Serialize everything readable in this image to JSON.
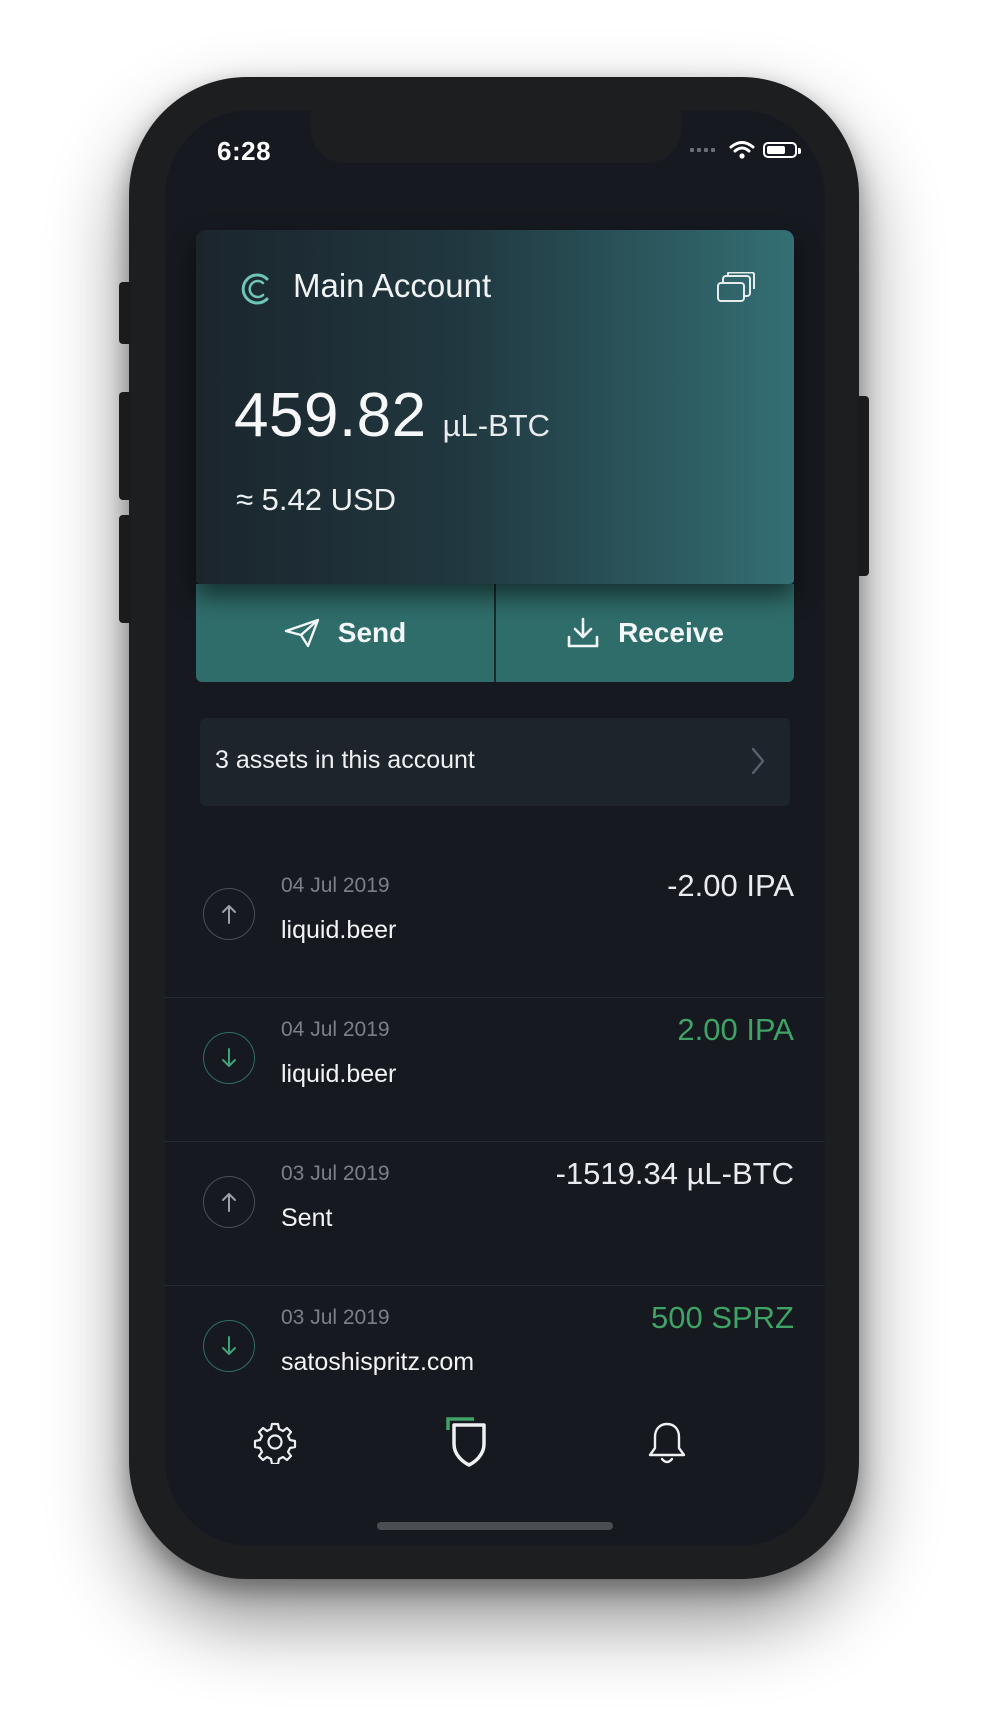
{
  "status_bar": {
    "time": "6:28"
  },
  "account_card": {
    "name": "Main Account",
    "balance": "459.82",
    "unit": "µL-BTC",
    "fiat": "≈ 5.42 USD"
  },
  "actions": {
    "send": "Send",
    "receive": "Receive"
  },
  "assets": {
    "label": "3 assets in this account"
  },
  "transactions": [
    {
      "date": "04 Jul 2019",
      "name": "liquid.beer",
      "amount": "-2.00 IPA",
      "direction": "outgoing"
    },
    {
      "date": "04 Jul 2019",
      "name": "liquid.beer",
      "amount": "2.00 IPA",
      "direction": "incoming"
    },
    {
      "date": "03 Jul 2019",
      "name": "Sent",
      "amount": "-1519.34 µL-BTC",
      "direction": "outgoing"
    },
    {
      "date": "03 Jul 2019",
      "name": "satoshispritz.com",
      "amount": "500 SPRZ",
      "direction": "incoming"
    }
  ],
  "tab_bar": {
    "items": [
      "settings-icon",
      "wallet-shield-icon",
      "notifications-bell-icon"
    ]
  },
  "colors": {
    "accent": "#2f6d6a",
    "incoming": "#3fa366",
    "background": "#16191f"
  }
}
